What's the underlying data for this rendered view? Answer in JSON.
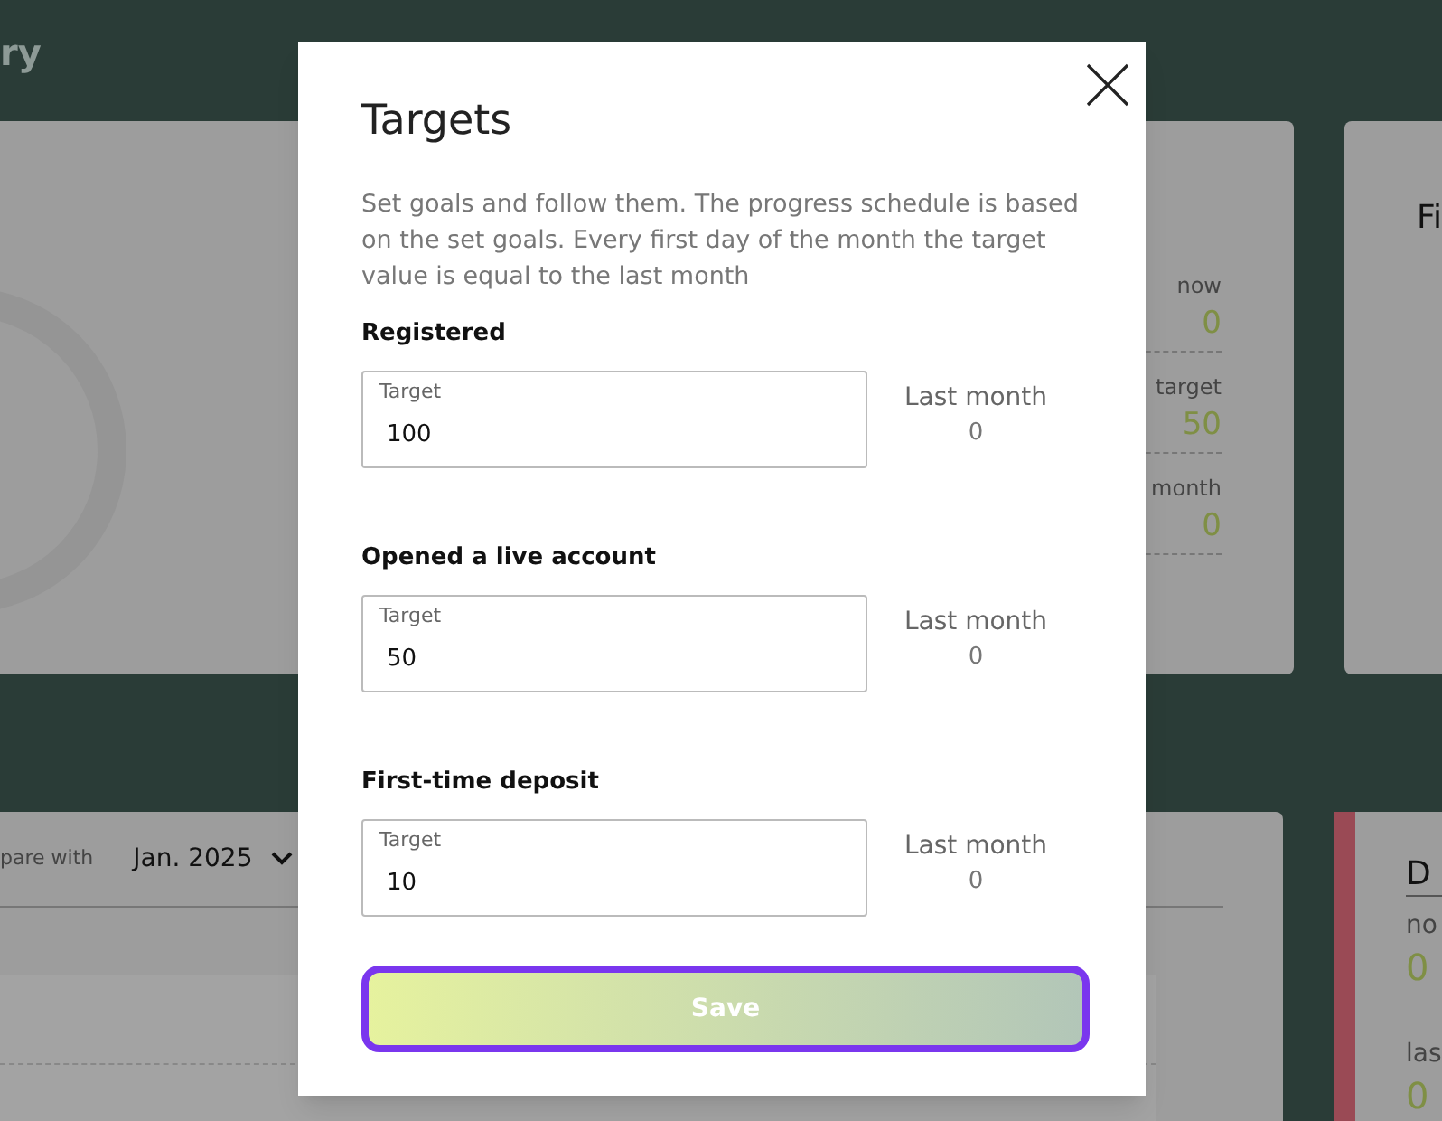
{
  "page_title": "ry",
  "summary_card": {
    "stats": [
      {
        "label": "now",
        "value": "0"
      },
      {
        "label": "target",
        "value": "50"
      },
      {
        "label": "month",
        "value": "0"
      }
    ]
  },
  "side_card": {
    "title": "Fi"
  },
  "compare": {
    "label": "pare with",
    "value": "Jan. 2025"
  },
  "deposit_card": {
    "color": "#9a4a55",
    "title": "D",
    "stats": [
      {
        "label": "no",
        "value": "0"
      },
      {
        "label": "las",
        "value": "0"
      }
    ]
  },
  "modal": {
    "title": "Targets",
    "description": "Set goals and follow them. The progress schedule is based on the set goals. Every first day of the month the target value is equal to the last month",
    "sections": [
      {
        "heading": "Registered",
        "field": {
          "label": "Target",
          "value": "100"
        },
        "last_month": {
          "label": "Last month",
          "value": "0"
        }
      },
      {
        "heading": "Opened a live account",
        "field": {
          "label": "Target",
          "value": "50"
        },
        "last_month": {
          "label": "Last month",
          "value": "0"
        }
      },
      {
        "heading": "First-time deposit",
        "field": {
          "label": "Target",
          "value": "10"
        },
        "last_month": {
          "label": "Last month",
          "value": "0"
        }
      }
    ],
    "save_button": "Save"
  }
}
